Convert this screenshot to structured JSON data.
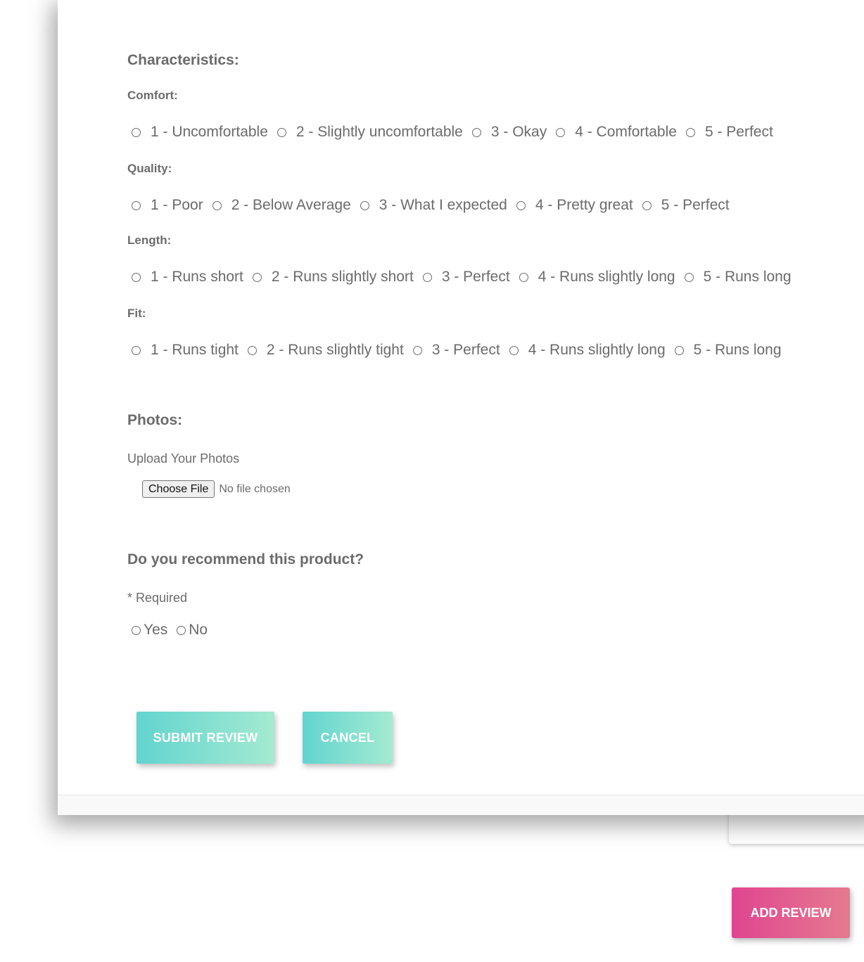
{
  "characteristics": {
    "heading": "Characteristics:",
    "groups": [
      {
        "label": "Comfort:",
        "options": [
          "1 - Uncomfortable",
          "2 - Slightly uncomfortable",
          "3 - Okay",
          "4 - Comfortable",
          "5 - Perfect"
        ]
      },
      {
        "label": "Quality:",
        "options": [
          "1 - Poor",
          "2 - Below Average",
          "3 - What I expected",
          "4 - Pretty great",
          "5 - Perfect"
        ]
      },
      {
        "label": "Length:",
        "options": [
          "1 - Runs short",
          "2 - Runs slightly short",
          "3 - Perfect",
          "4 - Runs slightly long",
          "5 - Runs long"
        ]
      },
      {
        "label": "Fit:",
        "options": [
          "1 - Runs tight",
          "2 - Runs slightly tight",
          "3 - Perfect",
          "4 - Runs slightly long",
          "5 - Runs long"
        ]
      }
    ]
  },
  "photos": {
    "heading": "Photos:",
    "upload_label": "Upload Your Photos",
    "choose_button": "Choose File",
    "file_status": "No file chosen"
  },
  "recommend": {
    "heading": "Do you recommend this product?",
    "required_note": "* Required",
    "options": [
      "Yes",
      "No"
    ]
  },
  "actions": {
    "submit": "SUBMIT REVIEW",
    "cancel": "CANCEL",
    "add_review": "ADD REVIEW"
  },
  "colors": {
    "text": "#6b6b6b",
    "teal_start": "#62d4cf",
    "teal_end": "#a4ead0",
    "pink_start": "#e04590",
    "pink_end": "#e57a8f"
  }
}
